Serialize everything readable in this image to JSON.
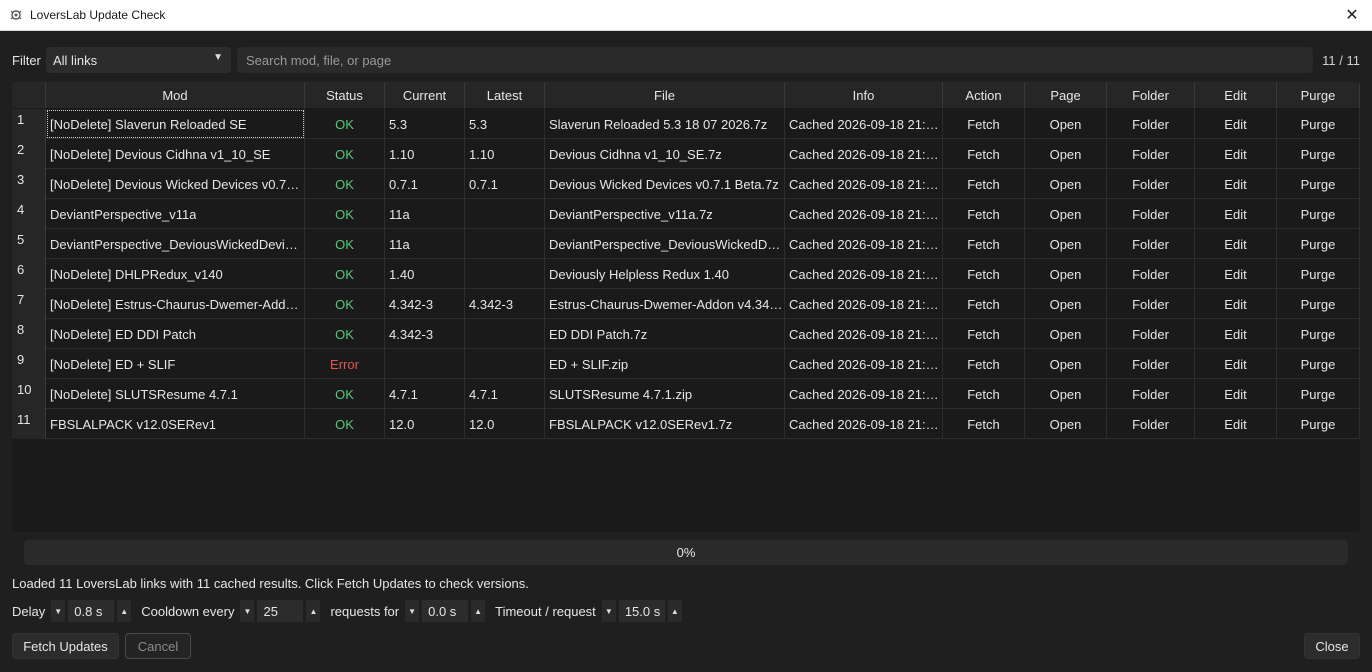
{
  "window": {
    "title": "LoversLab Update Check"
  },
  "filter": {
    "label": "Filter",
    "selected": "All links",
    "search_placeholder": "Search mod, file, or page",
    "count": "11 / 11"
  },
  "table": {
    "headers": [
      "",
      "Mod",
      "Status",
      "Current",
      "Latest",
      "File",
      "Info",
      "Action",
      "Page",
      "Folder",
      "Edit",
      "Purge"
    ],
    "rows": [
      {
        "n": "1",
        "mod": "[NoDelete] Slaverun Reloaded SE",
        "status": "OK",
        "current": "5.3",
        "latest": "5.3",
        "file": "Slaverun Reloaded 5.3 18 07 2026.7z",
        "info": "Cached 2026-09-18 21:1…",
        "action": "Fetch",
        "page": "Open",
        "folder": "Folder",
        "edit": "Edit",
        "purge": "Purge"
      },
      {
        "n": "2",
        "mod": "[NoDelete] Devious Cidhna v1_10_SE",
        "status": "OK",
        "current": "1.10",
        "latest": "1.10",
        "file": "Devious Cidhna v1_10_SE.7z",
        "info": "Cached 2026-09-18 21:1…",
        "action": "Fetch",
        "page": "Open",
        "folder": "Folder",
        "edit": "Edit",
        "purge": "Purge"
      },
      {
        "n": "3",
        "mod": "[NoDelete] Devious Wicked Devices v0.7…",
        "status": "OK",
        "current": "0.7.1",
        "latest": "0.7.1",
        "file": "Devious Wicked Devices v0.7.1 Beta.7z",
        "info": "Cached 2026-09-18 21:1…",
        "action": "Fetch",
        "page": "Open",
        "folder": "Folder",
        "edit": "Edit",
        "purge": "Purge"
      },
      {
        "n": "4",
        "mod": "DeviantPerspective_v11a",
        "status": "OK",
        "current": "11a",
        "latest": "",
        "file": "DeviantPerspective_v11a.7z",
        "info": "Cached 2026-09-18 21:1…",
        "action": "Fetch",
        "page": "Open",
        "folder": "Folder",
        "edit": "Edit",
        "purge": "Purge"
      },
      {
        "n": "5",
        "mod": "DeviantPerspective_DeviousWickedDevice…",
        "status": "OK",
        "current": "11a",
        "latest": "",
        "file": "DeviantPerspective_DeviousWickedDe…",
        "info": "Cached 2026-09-18 21:1…",
        "action": "Fetch",
        "page": "Open",
        "folder": "Folder",
        "edit": "Edit",
        "purge": "Purge"
      },
      {
        "n": "6",
        "mod": "[NoDelete] DHLPRedux_v140",
        "status": "OK",
        "current": "1.40",
        "latest": "",
        "file": "Deviously Helpless Redux 1.40",
        "info": "Cached 2026-09-18 21:1…",
        "action": "Fetch",
        "page": "Open",
        "folder": "Folder",
        "edit": "Edit",
        "purge": "Purge"
      },
      {
        "n": "7",
        "mod": "[NoDelete] Estrus-Chaurus-Dwemer-Add…",
        "status": "OK",
        "current": "4.342-3",
        "latest": "4.342-3",
        "file": "Estrus-Chaurus-Dwemer-Addon v4.34…",
        "info": "Cached 2026-09-18 21:1…",
        "action": "Fetch",
        "page": "Open",
        "folder": "Folder",
        "edit": "Edit",
        "purge": "Purge"
      },
      {
        "n": "8",
        "mod": "[NoDelete] ED DDI Patch",
        "status": "OK",
        "current": "4.342-3",
        "latest": "",
        "file": "ED DDI Patch.7z",
        "info": "Cached 2026-09-18 21:1…",
        "action": "Fetch",
        "page": "Open",
        "folder": "Folder",
        "edit": "Edit",
        "purge": "Purge"
      },
      {
        "n": "9",
        "mod": "[NoDelete] ED + SLIF",
        "status": "Error",
        "current": "",
        "latest": "",
        "file": "ED + SLIF.zip",
        "info": "Cached 2026-09-18 21:1…",
        "action": "Fetch",
        "page": "Open",
        "folder": "Folder",
        "edit": "Edit",
        "purge": "Purge"
      },
      {
        "n": "10",
        "mod": "[NoDelete] SLUTSResume 4.7.1",
        "status": "OK",
        "current": "4.7.1",
        "latest": "4.7.1",
        "file": "SLUTSResume 4.7.1.zip",
        "info": "Cached 2026-09-18 21:1…",
        "action": "Fetch",
        "page": "Open",
        "folder": "Folder",
        "edit": "Edit",
        "purge": "Purge"
      },
      {
        "n": "11",
        "mod": "FBSLALPACK v12.0SERev1",
        "status": "OK",
        "current": "12.0",
        "latest": "12.0",
        "file": "FBSLALPACK v12.0SERev1.7z",
        "info": "Cached 2026-09-18 21:1…",
        "action": "Fetch",
        "page": "Open",
        "folder": "Folder",
        "edit": "Edit",
        "purge": "Purge"
      }
    ]
  },
  "progress": {
    "label": "0%",
    "percent": 0
  },
  "status_line": "Loaded 11 LoversLab links with 11 cached results. Click Fetch Updates to check versions.",
  "settings": {
    "delay_label": "Delay",
    "delay_value": "0.8 s",
    "cooldown_label": "Cooldown every",
    "cooldown_value": "25",
    "requests_label": "requests for",
    "requests_value": "0.0 s",
    "timeout_label": "Timeout / request",
    "timeout_value": "15.0 s"
  },
  "buttons": {
    "fetch": "Fetch Updates",
    "cancel": "Cancel",
    "close": "Close"
  },
  "colors": {
    "ok": "#58c77a",
    "error": "#e05555",
    "background": "#1f1f1f"
  },
  "icons": {
    "app": "bug-icon",
    "close": "close-icon",
    "dropdown": "chevron-down-icon",
    "spin_down": "chevron-down-icon",
    "spin_up": "chevron-up-icon"
  }
}
